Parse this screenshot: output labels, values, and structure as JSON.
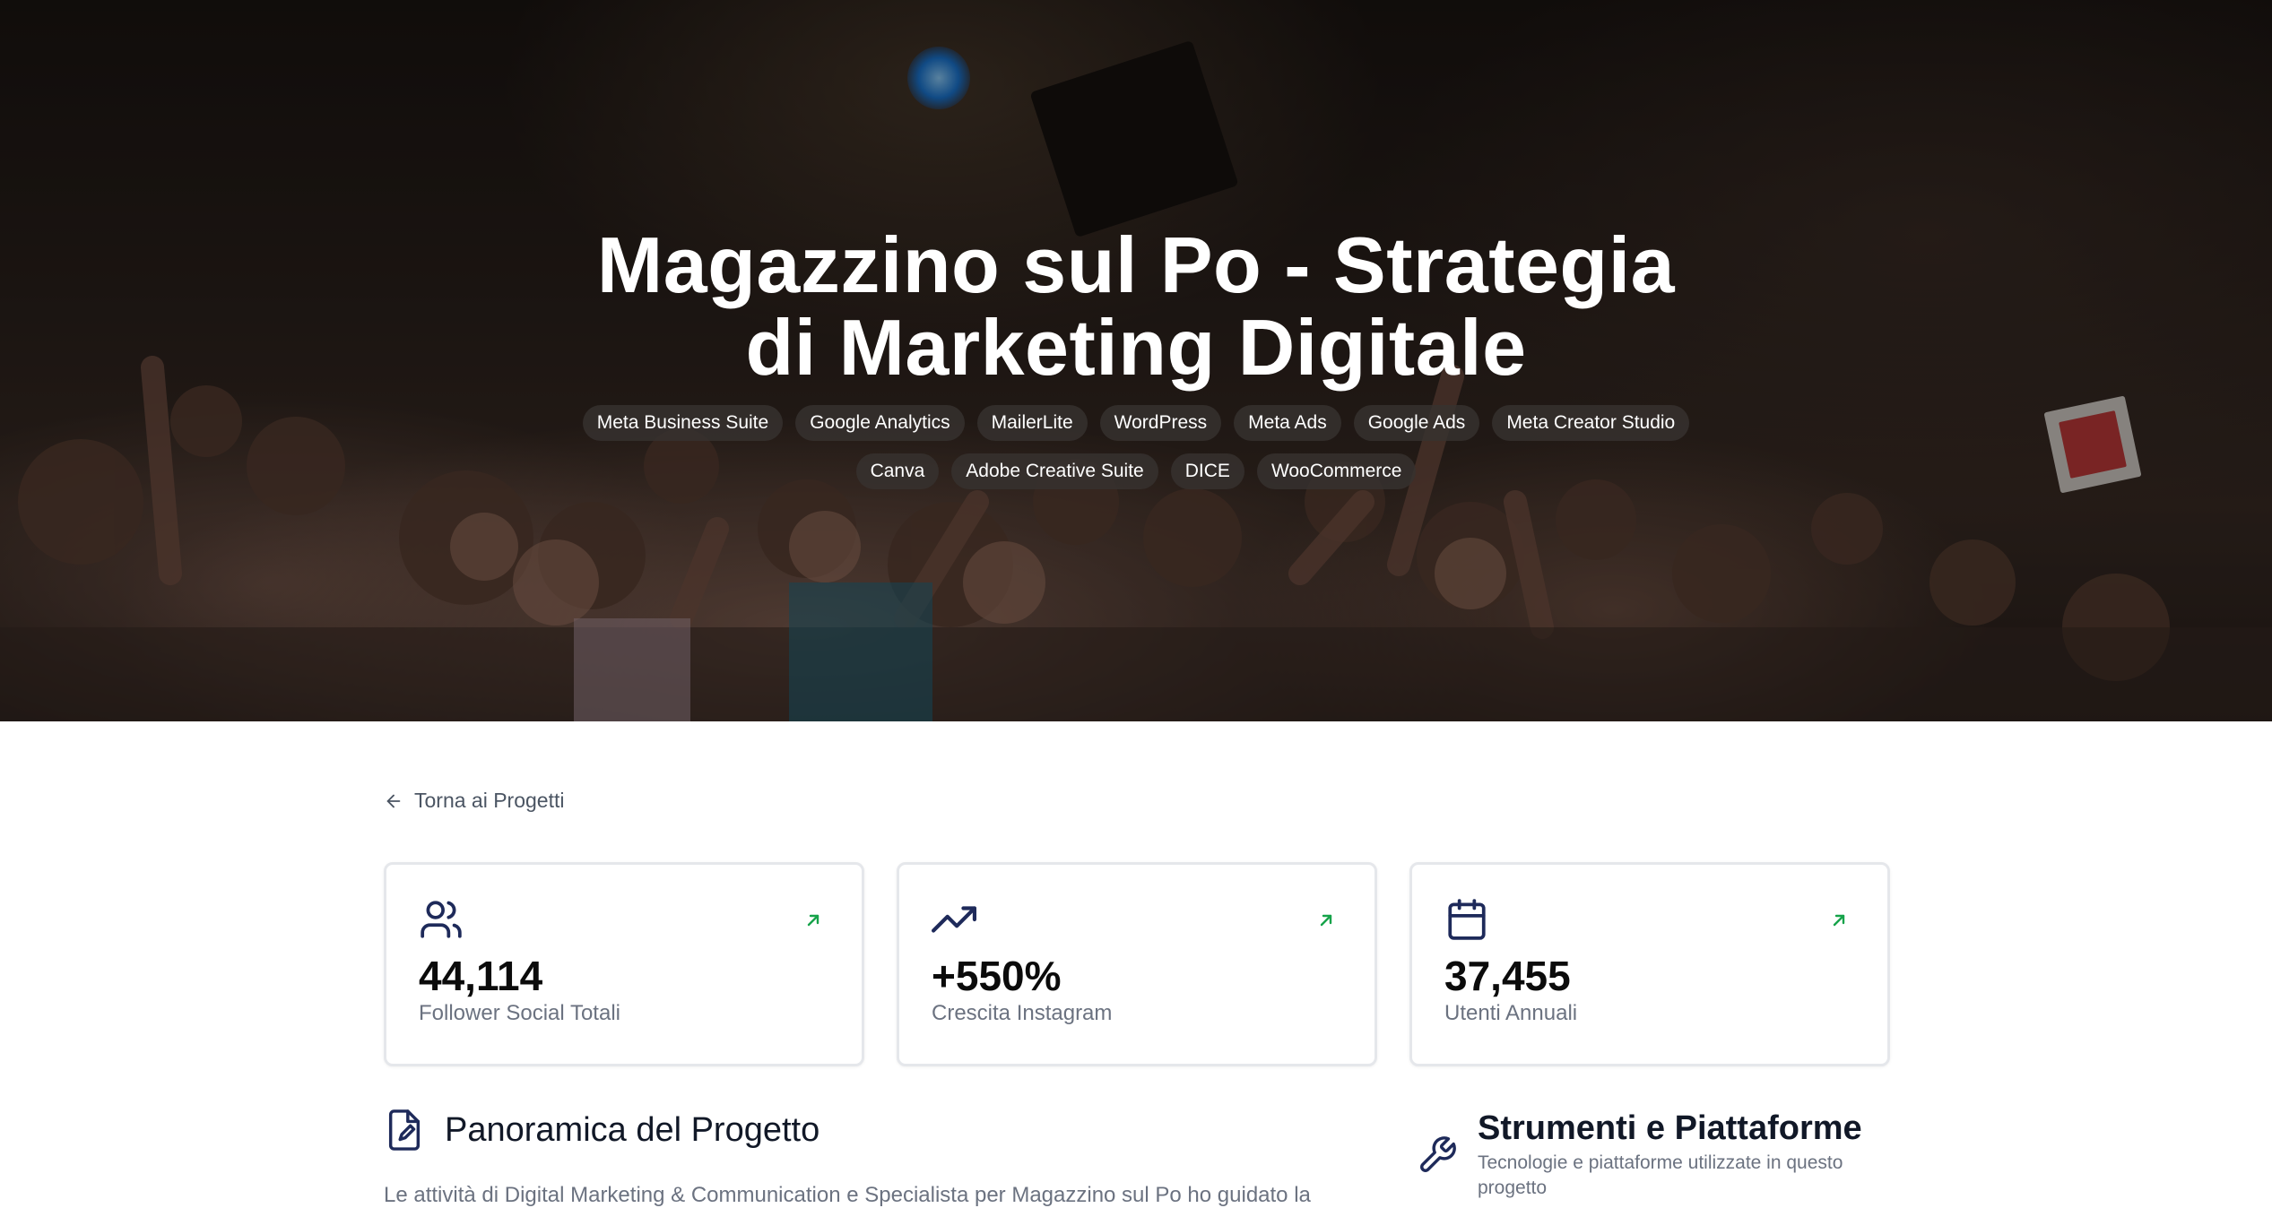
{
  "hero": {
    "title": "Magazzino sul Po - Strategia di Marketing Digitale",
    "tags": [
      "Meta Business Suite",
      "Google Analytics",
      "MailerLite",
      "WordPress",
      "Meta Ads",
      "Google Ads",
      "Meta Creator Studio",
      "Canva",
      "Adobe Creative Suite",
      "DICE",
      "WooCommerce"
    ]
  },
  "nav": {
    "back_label": "Torna ai Progetti"
  },
  "stats": [
    {
      "icon": "users-icon",
      "value": "44,114",
      "label": "Follower Social Totali",
      "trend": "arrow-up-right-icon"
    },
    {
      "icon": "trending-up-icon",
      "value": "+550%",
      "label": "Crescita Instagram",
      "trend": "arrow-up-right-icon"
    },
    {
      "icon": "calendar-icon",
      "value": "37,455",
      "label": "Utenti Annuali",
      "trend": "arrow-up-right-icon"
    }
  ],
  "overview": {
    "title": "Panoramica del Progetto",
    "text": "Le attività di Digital Marketing & Communication e Specialista per Magazzino sul Po ho guidato la"
  },
  "tools": {
    "title": "Strumenti e Piattaforme",
    "subtitle": "Tecnologie e piattaforme utilizzate in questo progetto"
  },
  "colors": {
    "accent": "#1e2a5a",
    "trend_green": "#16a34a",
    "muted_text": "#6b7280"
  }
}
